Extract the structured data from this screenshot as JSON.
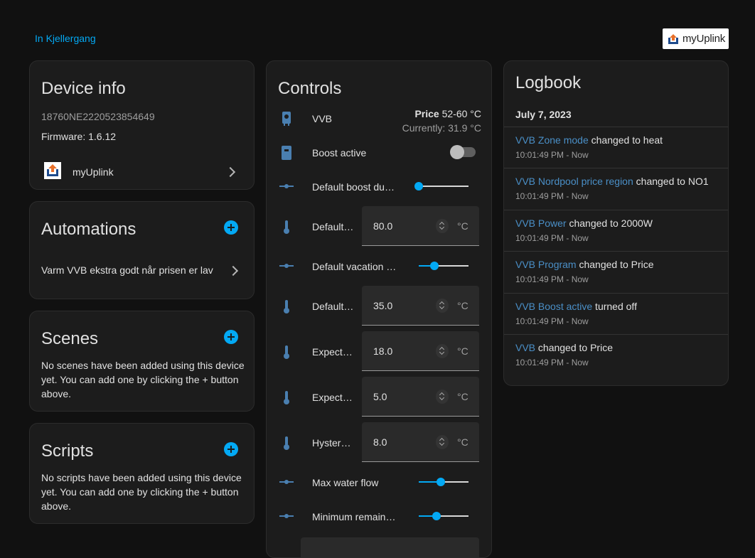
{
  "breadcrumb": {
    "area_link": "In Kjellergang"
  },
  "brand": {
    "logo_text": "myUplink",
    "accent_colors": [
      "#e8702a",
      "#1e4a8c"
    ]
  },
  "device_info": {
    "title": "Device info",
    "serial": "18760NE2220523854649",
    "firmware": "Firmware: 1.6.12",
    "integration_label": "myUplink"
  },
  "automations": {
    "title": "Automations",
    "items": [
      {
        "label": "Varm VVB ekstra godt når prisen er lav"
      }
    ]
  },
  "scenes": {
    "title": "Scenes",
    "empty_text": "No scenes have been added using this device yet. You can add one by clicking the + button above."
  },
  "scripts": {
    "title": "Scripts",
    "empty_text": "No scripts have been added using this device yet. You can add one by clicking the + button above."
  },
  "controls": {
    "title": "Controls",
    "water_heater": {
      "label": "VVB",
      "price_label": "Price",
      "price_range": "52-60 °C",
      "current": "Currently: 31.9 °C"
    },
    "boost": {
      "label": "Boost active",
      "on": false
    },
    "sliders": [
      {
        "label": "Default boost duration",
        "level": 0.0
      },
      {
        "label": "Default vacation duration",
        "level": 0.32
      },
      {
        "label": "Max water flow",
        "level": 0.44
      },
      {
        "label": "Minimum remaining hot water",
        "level": 0.36
      }
    ],
    "numbers": [
      {
        "label": "Default boost temperature",
        "value": "80.0",
        "unit": "°C"
      },
      {
        "label": "Default vacation temperature",
        "value": "35.0",
        "unit": "°C"
      },
      {
        "label": "Expected cold water temperature",
        "value": "18.0",
        "unit": "°C"
      },
      {
        "label": "Expected minimum temperature",
        "value": "5.0",
        "unit": "°C"
      },
      {
        "label": "Hysteresis",
        "value": "8.0",
        "unit": "°C"
      }
    ]
  },
  "logbook": {
    "title": "Logbook",
    "date": "July 7, 2023",
    "entries": [
      {
        "entity": "VVB Zone mode",
        "text": " changed to heat",
        "time": "10:01:49 PM - Now"
      },
      {
        "entity": "VVB Nordpool price region",
        "text": " changed to NO1",
        "time": "10:01:49 PM - Now"
      },
      {
        "entity": "VVB Power",
        "text": " changed to 2000W",
        "time": "10:01:49 PM - Now"
      },
      {
        "entity": "VVB Program",
        "text": " changed to Price",
        "time": "10:01:49 PM - Now"
      },
      {
        "entity": "VVB Boost active",
        "text": " turned off",
        "time": "10:01:49 PM - Now"
      },
      {
        "entity": "VVB",
        "text": " changed to Price",
        "time": "10:01:49 PM - Now"
      }
    ]
  },
  "accent_color": "#03a9f4"
}
